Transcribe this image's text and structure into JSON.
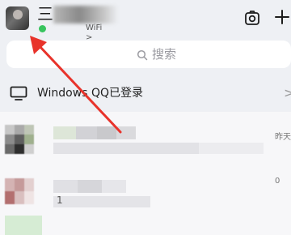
{
  "header": {
    "name_visible": "三",
    "status_text": "WiFi >",
    "status_color": "#38c45e"
  },
  "icons": {
    "camera": "camera-icon",
    "add": "plus-icon",
    "search": "search-icon",
    "device": "monitor-icon",
    "arrow": "chevron-right-icon"
  },
  "search": {
    "placeholder": "搜索"
  },
  "device_row": {
    "label": "Windows QQ已登录",
    "chevron": ">"
  },
  "chats": [
    {
      "time": "昨天",
      "snippet": ""
    },
    {
      "time": "0",
      "snippet": "1"
    }
  ],
  "annotation": {
    "color": "#e8332b"
  }
}
